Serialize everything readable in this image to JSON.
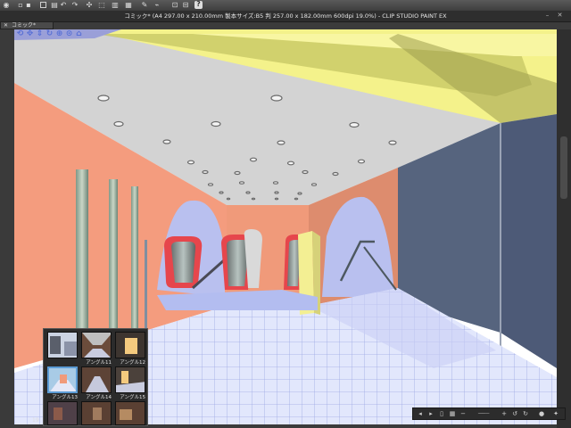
{
  "window": {
    "title": "コミック* (A4 297.00 x 210.00mm 製本サイズ:B5 判 257.00 x 182.00mm 600dpi 19.0%)  - CLIP STUDIO PAINT EX"
  },
  "document_tab": {
    "label": "コミック*",
    "close_symbol": "✕"
  },
  "toolbar": {
    "icons": [
      "eye-icon",
      "new-file-icon",
      "open-file-icon",
      "save-icon",
      "square-icon",
      "undo-icon",
      "redo-icon",
      "move-icon",
      "transform-icon",
      "clear-icon",
      "fill-icon",
      "pen-icon",
      "vector-icon",
      "select-icon",
      "ruler-icon",
      "help-icon"
    ]
  },
  "canvas_widget": {
    "icons": [
      "camera-rotate-icon",
      "pan-icon",
      "dolly-icon",
      "rotate-icon",
      "reset-icon",
      "ground-icon",
      "perspective-icon"
    ]
  },
  "material_panel": {
    "thumbnails": [
      {
        "label": ""
      },
      {
        "label": "アングル11"
      },
      {
        "label": "アングル12"
      },
      {
        "label": "アングル13"
      },
      {
        "label": "アングル14"
      },
      {
        "label": "アングル15"
      },
      {
        "label": ""
      },
      {
        "label": ""
      },
      {
        "label": ""
      }
    ],
    "zoom_value": "19"
  },
  "statusbar": {
    "icons": [
      "prev-icon",
      "next-icon",
      "fit-icon",
      "grid-icon",
      "zoom-out-icon",
      "zoom-slider-icon",
      "zoom-in-icon",
      "rotate-left-icon",
      "rotate-right-icon",
      "navigator-icon",
      "settings-icon"
    ]
  },
  "colors": {
    "ceiling": "#d4d4d4",
    "wall_left": "#f39b7d",
    "wall_right": "#56647e",
    "floor": "#dfe4fb",
    "skylight": "#f4f28a",
    "escalator_rail": "#e6464c",
    "ui_dark": "#2e2e2e",
    "accent_icon": "#5870d6"
  }
}
